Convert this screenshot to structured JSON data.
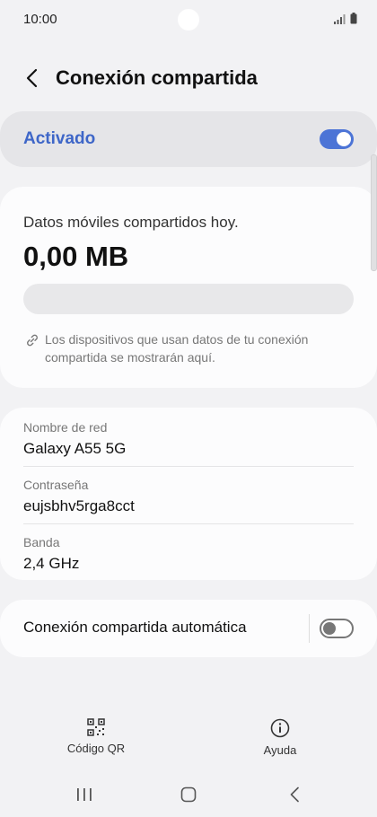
{
  "status_bar": {
    "time": "10:00"
  },
  "header": {
    "title": "Conexión compartida"
  },
  "master_switch": {
    "label": "Activado",
    "enabled": true,
    "accent_color": "#4c74d6",
    "label_color": "#3e66c8"
  },
  "usage": {
    "label": "Datos móviles compartidos hoy.",
    "value": "0,00 MB",
    "progress_fraction": 0,
    "info_line1": "Los dispositivos que usan datos de tu conexión",
    "info_line2": "compartida se mostrarán aquí."
  },
  "network": {
    "name_label": "Nombre de red",
    "name_value": "Galaxy A55 5G",
    "password_label": "Contraseña",
    "password_value": "eujsbhv5rga8cct",
    "band_label": "Banda",
    "band_value": "2,4 GHz"
  },
  "auto_hotspot": {
    "label": "Conexión compartida automática",
    "enabled": false
  },
  "bottom_bar": {
    "qr_label": "Código QR",
    "help_label": "Ayuda"
  },
  "icons": {
    "back": "chevron-left-icon",
    "link": "link-icon",
    "qr": "qr-code-icon",
    "help": "info-icon",
    "signal": "signal-icon",
    "battery": "battery-icon"
  }
}
